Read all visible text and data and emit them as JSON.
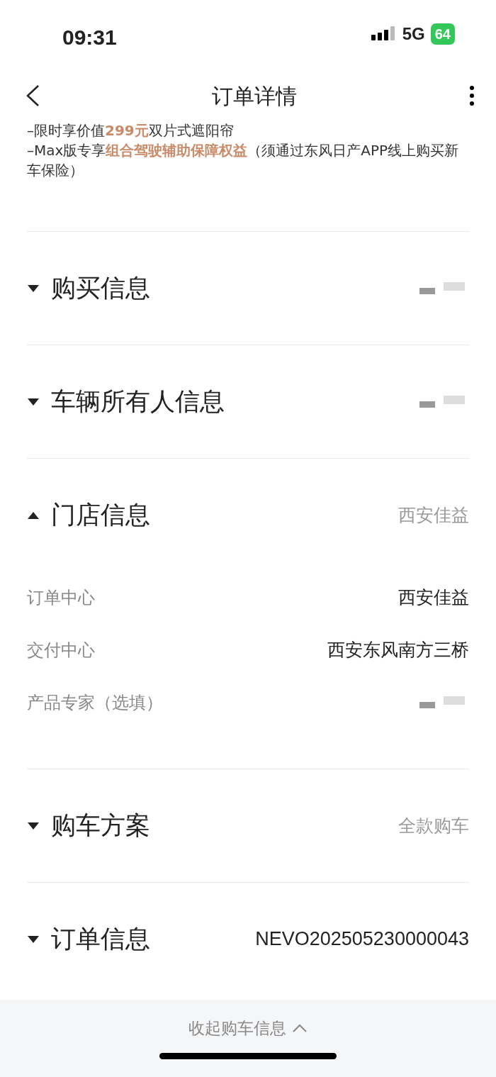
{
  "status_bar": {
    "time": "09:31",
    "network": "5G",
    "battery": "64"
  },
  "header": {
    "title": "订单详情"
  },
  "notes": [
    "–限时享价值**299元**双片式遮阳帘",
    "–Max版专享**组合驾驶辅助保障权益**（须通过东风日产APP线上购买新车保险）"
  ],
  "sections": [
    {
      "title": "购买信息",
      "expanded": false,
      "blurred": true
    },
    {
      "title": "车辆所有人信息",
      "expanded": false,
      "blurred": true
    },
    {
      "title": "门店信息",
      "expanded": true,
      "value": "西安佳益",
      "rows": [
        {
          "label": "订单中心",
          "value": "西安佳益"
        },
        {
          "label": "交付中心",
          "value": "西安东风南方三桥"
        },
        {
          "label": "产品专家（选填）",
          "blurred": true
        }
      ]
    },
    {
      "title": "购车方案",
      "expanded": false,
      "value": "全款购车"
    },
    {
      "title": "订单信息",
      "expanded": false,
      "value": "NEVO202505230000043",
      "value_dark": true
    }
  ],
  "footer": {
    "label": "收起购车信息"
  }
}
